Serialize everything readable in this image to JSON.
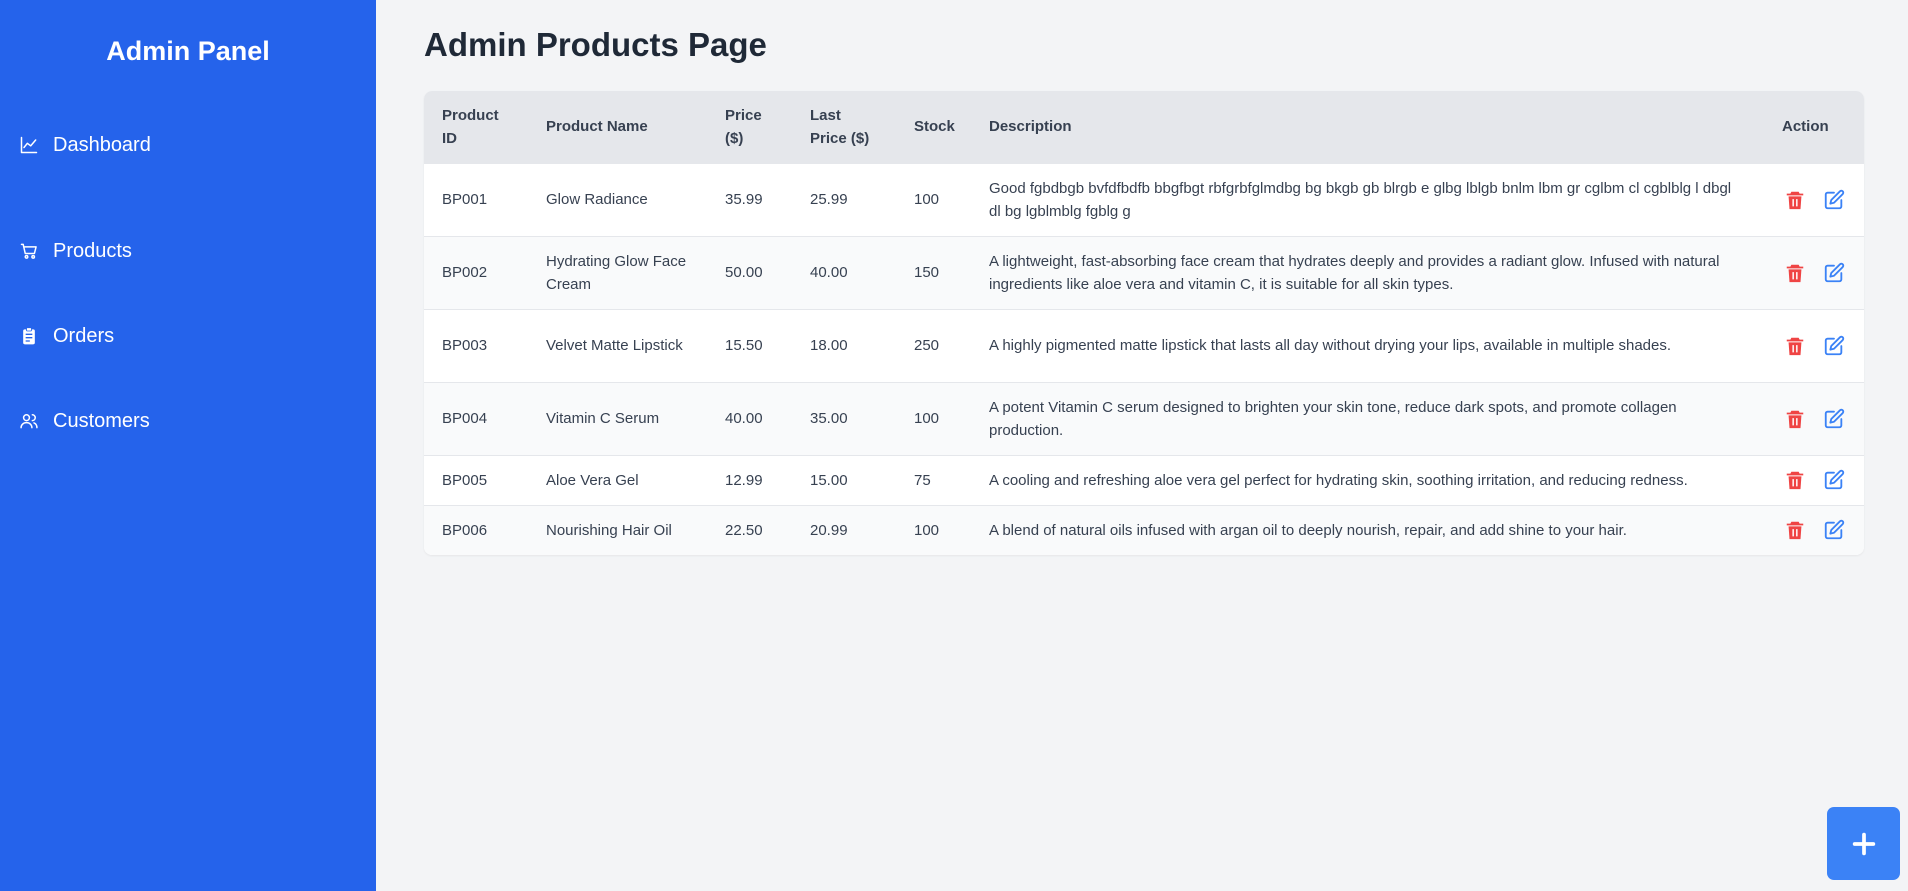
{
  "sidebar": {
    "brand": "Admin Panel",
    "items": [
      {
        "label": "Dashboard",
        "icon": "chart-line-icon"
      },
      {
        "label": "Products",
        "icon": "cart-icon"
      },
      {
        "label": "Orders",
        "icon": "clipboard-icon"
      },
      {
        "label": "Customers",
        "icon": "users-icon"
      }
    ]
  },
  "page": {
    "title": "Admin Products Page"
  },
  "table": {
    "headers": {
      "id": "Product ID",
      "name": "Product Name",
      "price": "Price ($)",
      "last_price": "Last Price ($)",
      "stock": "Stock",
      "description": "Description",
      "action": "Action"
    },
    "rows": [
      {
        "id": "BP001",
        "name": "Glow Radiance",
        "price": "35.99",
        "last_price": "25.99",
        "stock": "100",
        "description": "Good fgbdbgb bvfdfbdfb bbgfbgt rbfgrbfglmdbg bg bkgb gb blrgb e glbg lblgb bnlm lbm gr cglbm cl cgblblg l dbgl dl bg lgblmblg fgblg g"
      },
      {
        "id": "BP002",
        "name": "Hydrating Glow Face Cream",
        "price": "50.00",
        "last_price": "40.00",
        "stock": "150",
        "description": "A lightweight, fast-absorbing face cream that hydrates deeply and provides a radiant glow. Infused with natural ingredients like aloe vera and vitamin C, it is suitable for all skin types."
      },
      {
        "id": "BP003",
        "name": "Velvet Matte Lipstick",
        "price": "15.50",
        "last_price": "18.00",
        "stock": "250",
        "description": "A highly pigmented matte lipstick that lasts all day without drying your lips, available in multiple shades."
      },
      {
        "id": "BP004",
        "name": "Vitamin C Serum",
        "price": "40.00",
        "last_price": "35.00",
        "stock": "100",
        "description": "A potent Vitamin C serum designed to brighten your skin tone, reduce dark spots, and promote collagen production."
      },
      {
        "id": "BP005",
        "name": "Aloe Vera Gel",
        "price": "12.99",
        "last_price": "15.00",
        "stock": "75",
        "description": "A cooling and refreshing aloe vera gel perfect for hydrating skin, soothing irritation, and reducing redness."
      },
      {
        "id": "BP006",
        "name": "Nourishing Hair Oil",
        "price": "22.50",
        "last_price": "20.99",
        "stock": "100",
        "description": "A blend of natural oils infused with argan oil to deeply nourish, repair, and add shine to your hair."
      }
    ],
    "row_icons": {
      "delete": "trash-icon",
      "edit": "edit-icon"
    }
  },
  "fab": {
    "icon": "plus-icon"
  },
  "colors": {
    "sidebar": "#2563eb",
    "delete": "#ef4444",
    "edit": "#3b82f6",
    "fab": "#3b82f6"
  }
}
